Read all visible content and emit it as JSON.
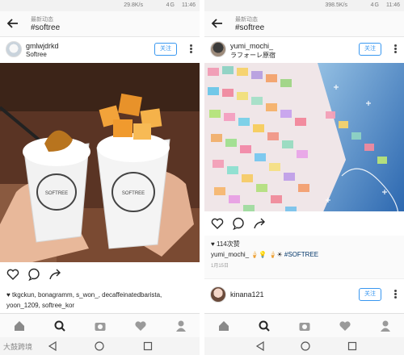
{
  "status_bar": {
    "left": {
      "net_speed": "29.8K/s",
      "signal": "4G",
      "time": "11:46"
    },
    "right": {
      "net_speed": "398.5K/s",
      "signal": "4G",
      "time": "11:46"
    }
  },
  "header": {
    "subtitle": "最新动态",
    "title": "#softree",
    "back_icon": "back-arrow-icon"
  },
  "left_post": {
    "username": "gmlwjdrkd",
    "location": "Softree",
    "follow_label": "关注",
    "likers_line1": "tkgckun, bonagramm, s_won_, decaffeinatedbarista,",
    "likers_line2": "yoon_1209, softree_kor",
    "photo_description_colors": {
      "bg": "#6b3a28",
      "cup": "#f2f2f2",
      "topping": "#e8922a",
      "honey": "#b8741e"
    }
  },
  "right_post": {
    "username": "yumi_mochi_",
    "location": "ラフォーレ原宿",
    "follow_label": "关注",
    "likes_count": "114次赞",
    "caption_user": "yumi_mochi_",
    "caption_emoji": "🍦💡 🍦☀",
    "caption_tag": "#SOFTREE",
    "date": "1月15日",
    "next_username": "kinana121",
    "next_follow_label": "关注"
  },
  "bottom_nav": {
    "items": [
      "home-icon",
      "search-icon",
      "camera-icon",
      "heart-icon",
      "profile-icon"
    ]
  },
  "watermark": "大鼓跨境",
  "colors": {
    "accent": "#3897f0",
    "text": "#262626",
    "muted": "#8a8a8a"
  }
}
